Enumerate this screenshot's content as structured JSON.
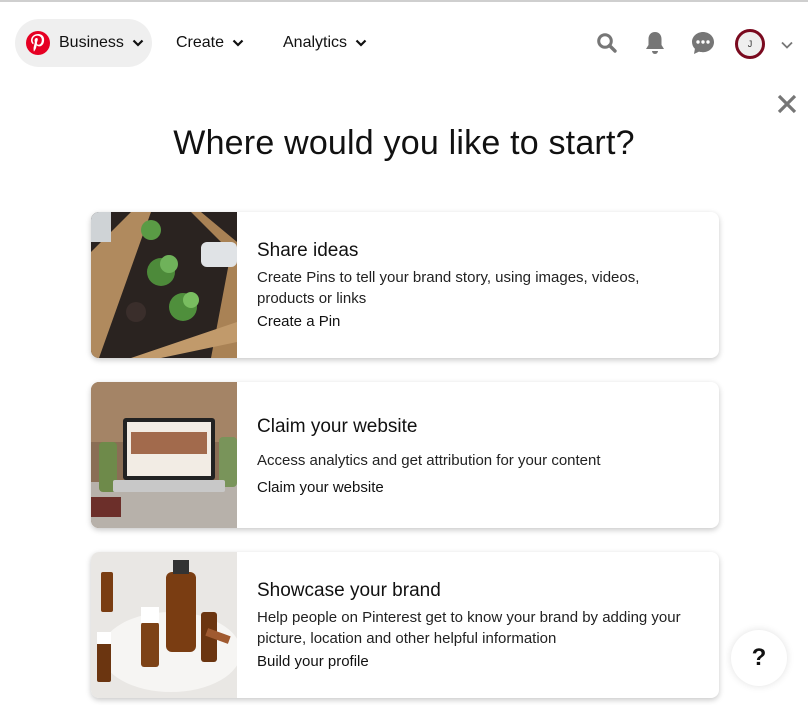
{
  "nav": {
    "business_label": "Business",
    "create_label": "Create",
    "analytics_label": "Analytics",
    "avatar_initial": "J",
    "brand_color": "#e60023",
    "avatar_ring_color": "#7a0a1f"
  },
  "dialog": {
    "title": "Where would you like to start?",
    "cards": [
      {
        "title": "Share ideas",
        "description": "Create Pins to tell your brand story, using images, videos, products or links",
        "link": "Create a Pin",
        "image": "garden-planter-photo"
      },
      {
        "title": "Claim your website",
        "description": "Access analytics and get attribution for your content",
        "link": "Claim your website",
        "image": "laptop-website-photo"
      },
      {
        "title": "Showcase your brand",
        "description": "Help people on Pinterest get to know your brand by adding your picture, location and other helpful information",
        "link": "Build your profile",
        "image": "amber-bottles-photo"
      }
    ]
  },
  "help": {
    "label": "?"
  }
}
